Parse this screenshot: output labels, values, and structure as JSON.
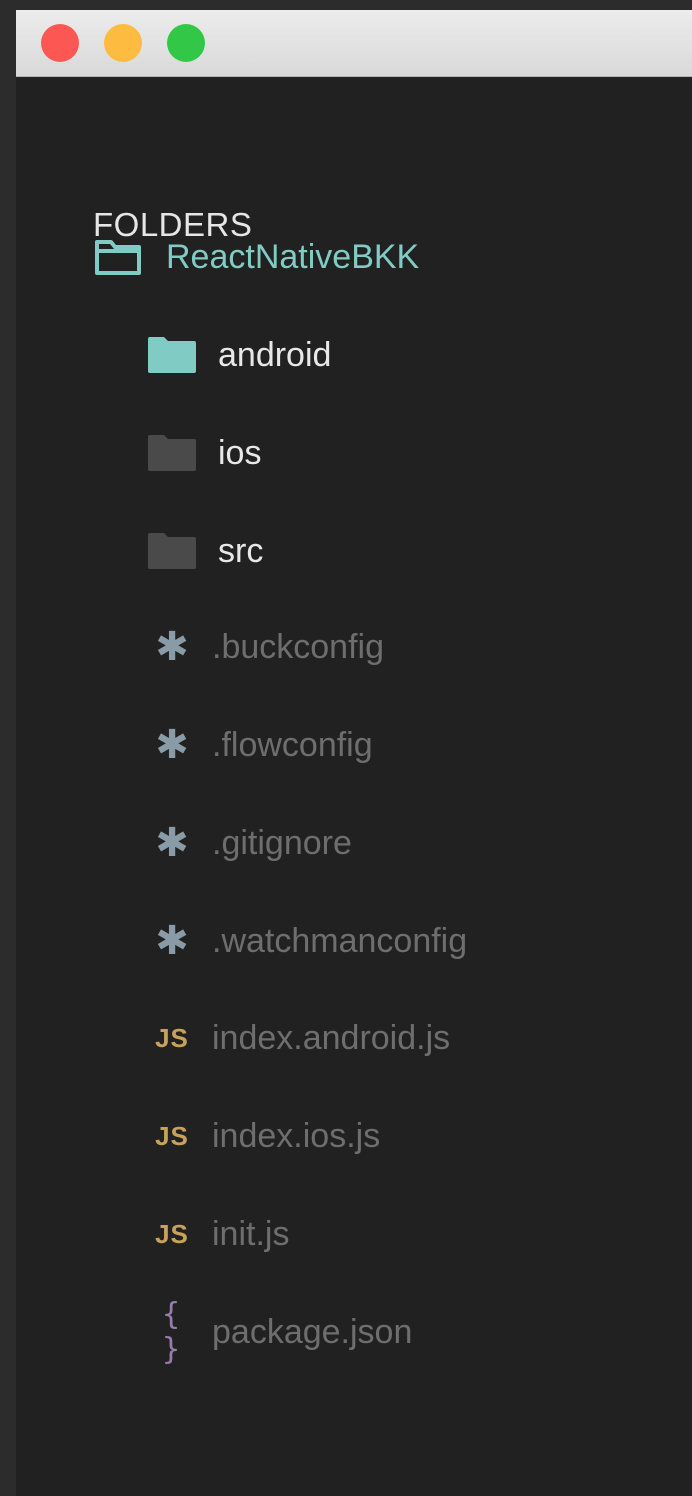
{
  "window": {
    "traffic_lights": {
      "close_color": "#fc5753",
      "minimize_color": "#fdbc40",
      "zoom_color": "#33c748"
    }
  },
  "sidebar": {
    "header": "FOLDERS",
    "root_folder": {
      "name": "ReactNativeBKK",
      "icon": "folder-outline-icon",
      "color": "#80cbc4"
    },
    "folders": [
      {
        "name": "android",
        "icon": "folder-icon",
        "icon_color": "#80cbc4",
        "text_color": "#e8e8e8",
        "selected": true
      },
      {
        "name": "ios",
        "icon": "folder-icon",
        "icon_color": "#4a4a4a",
        "text_color": "#e8e8e8",
        "selected": false
      },
      {
        "name": "src",
        "icon": "folder-icon",
        "icon_color": "#4a4a4a",
        "text_color": "#e8e8e8",
        "selected": false
      }
    ],
    "files": [
      {
        "name": ".buckconfig",
        "icon": "asterisk-icon",
        "icon_glyph": "✱",
        "icon_color": "#8a9ba8"
      },
      {
        "name": ".flowconfig",
        "icon": "asterisk-icon",
        "icon_glyph": "✱",
        "icon_color": "#8a9ba8"
      },
      {
        "name": ".gitignore",
        "icon": "asterisk-icon",
        "icon_glyph": "✱",
        "icon_color": "#8a9ba8"
      },
      {
        "name": ".watchmanconfig",
        "icon": "asterisk-icon",
        "icon_glyph": "✱",
        "icon_color": "#8a9ba8"
      },
      {
        "name": "index.android.js",
        "icon": "js-icon",
        "icon_glyph": "JS",
        "icon_color": "#c9a25a"
      },
      {
        "name": "index.ios.js",
        "icon": "js-icon",
        "icon_glyph": "JS",
        "icon_color": "#c9a25a"
      },
      {
        "name": "init.js",
        "icon": "js-icon",
        "icon_glyph": "JS",
        "icon_color": "#c9a25a"
      },
      {
        "name": "package.json",
        "icon": "json-braces-icon",
        "icon_glyph": "{ }",
        "icon_color": "#9a7bb0"
      }
    ],
    "file_text_color": "#6e6e6e"
  }
}
